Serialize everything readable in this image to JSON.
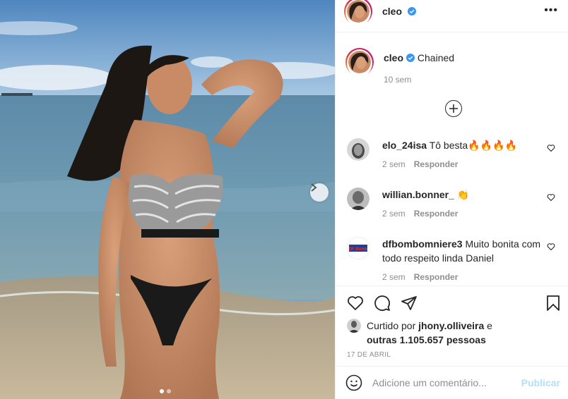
{
  "post": {
    "username": "cleo",
    "verified": true,
    "more_icon": "more-horizontal-icon",
    "caption": {
      "username": "cleo",
      "text": "Chained",
      "time": "10 sem"
    },
    "load_more_icon": "plus-circle-icon",
    "carousel": {
      "current_slide": 1,
      "total_slides": 2,
      "next_icon": "chevron-right-icon"
    }
  },
  "comments": [
    {
      "username": "elo_24isa",
      "text": "Tô besta🔥🔥🔥🔥",
      "time": "2 sem",
      "reply_label": "Responder"
    },
    {
      "username": "willian.bonner_",
      "text": "👏",
      "time": "2 sem",
      "reply_label": "Responder"
    },
    {
      "username": "dfbombomniere3",
      "text": "Muito bonita com todo respeito linda Daniel",
      "time": "2 sem",
      "reply_label": "Responder",
      "avatar_text": "DF Bomb"
    }
  ],
  "actions": {
    "like_icon": "heart-icon",
    "comment_icon": "comment-icon",
    "share_icon": "paper-plane-icon",
    "save_icon": "bookmark-icon"
  },
  "likes": {
    "prefix": "Curtido por",
    "user": "jhony.olliveira",
    "connector": "e",
    "others": "outras 1.105.657 pessoas"
  },
  "date": "17 DE ABRIL",
  "add_comment": {
    "placeholder": "Adicione um comentário...",
    "publish_label": "Publicar",
    "emoji_icon": "emoji-icon"
  },
  "colors": {
    "accent": "#0095f6",
    "publish_disabled": "#b2dffc",
    "muted": "#8e8e8e",
    "text": "#262626"
  }
}
